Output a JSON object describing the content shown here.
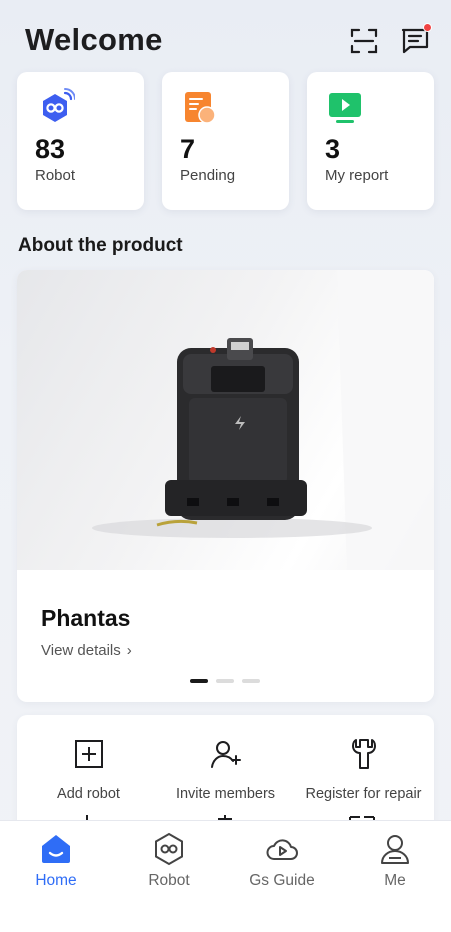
{
  "header": {
    "title": "Welcome",
    "scan_icon": "scan-icon",
    "messages_icon": "message-icon",
    "has_unread": true
  },
  "stats": [
    {
      "value": "83",
      "label": "Robot",
      "icon": "robot-connected-icon",
      "color": "#3d5ef0"
    },
    {
      "value": "7",
      "label": "Pending",
      "icon": "pending-document-icon",
      "color": "#f7852f"
    },
    {
      "value": "3",
      "label": "My report",
      "icon": "report-play-icon",
      "color": "#1fc26b"
    }
  ],
  "about": {
    "section_title": "About the product",
    "carousel": {
      "product_name": "Phantas",
      "view_details": "View details",
      "slide_count": 3,
      "active_slide": 0
    }
  },
  "actions": [
    {
      "label": "Add robot",
      "icon": "add-box-icon"
    },
    {
      "label": "Invite members",
      "icon": "add-user-icon"
    },
    {
      "label": "Register for repair",
      "icon": "wrench-icon"
    }
  ],
  "tabs": [
    {
      "label": "Home",
      "icon": "home-icon",
      "active": true
    },
    {
      "label": "Robot",
      "icon": "robot-hex-icon",
      "active": false
    },
    {
      "label": "Gs Guide",
      "icon": "cloud-play-icon",
      "active": false
    },
    {
      "label": "Me",
      "icon": "person-icon",
      "active": false
    }
  ],
  "colors": {
    "accent": "#2f6df6",
    "badge": "#f04343"
  }
}
